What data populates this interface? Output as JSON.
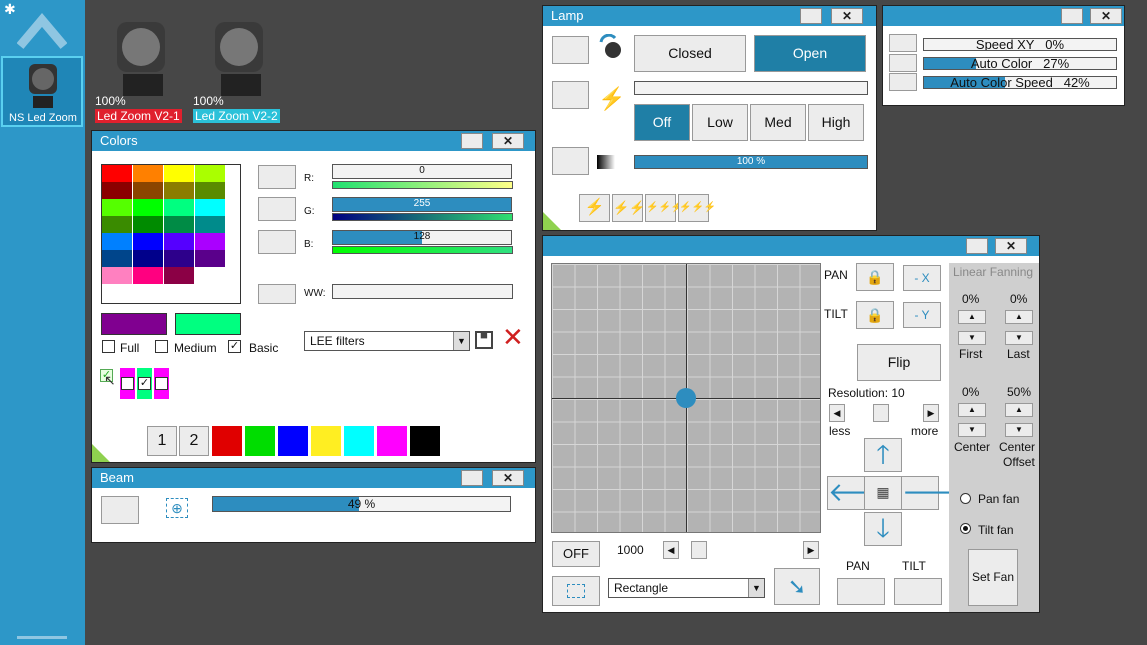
{
  "sidebar": {
    "fixture_label": "NS Led Zoom"
  },
  "fixtures": [
    {
      "percent": "100%",
      "name": "Led Zoom V2-1",
      "color": "#e0202d"
    },
    {
      "percent": "100%",
      "name": "Led Zoom V2-2",
      "color": "#2bc1d9"
    }
  ],
  "colors_panel": {
    "title": "Colors",
    "palette": [
      [
        "#ff0000",
        "#ff8000",
        "#ffff00",
        "#aaff00"
      ],
      [
        "#8b0000",
        "#8b4500",
        "#8b7d00",
        "#5a8b00"
      ],
      [
        "#55ff00",
        "#00ff00",
        "#00ff80",
        "#00ffff"
      ],
      [
        "#3a8b00",
        "#008b00",
        "#008b45",
        "#008b8b"
      ],
      [
        "#0080ff",
        "#0000ff",
        "#5500ff",
        "#aa00ff"
      ],
      [
        "#00458b",
        "#00008b",
        "#2d008b",
        "#5a008b"
      ],
      [
        "#ff80c0",
        "#ff0080",
        "#8b0045",
        "#ffffff"
      ]
    ],
    "r_label": "R:",
    "r_value": "0",
    "r_fraction": 0,
    "g_label": "G:",
    "g_value": "255",
    "g_fraction": 1,
    "b_label": "B:",
    "b_value": "128",
    "b_fraction": 0.5,
    "ww_label": "WW:",
    "preview_a": "#800090",
    "preview_b": "#00ff80",
    "opt_full": "Full",
    "opt_medium": "Medium",
    "opt_basic": "Basic",
    "filter_select": "LEE filters",
    "page_1": "1",
    "page_2": "2",
    "quick_colors": [
      "#e00000",
      "#00dd00",
      "#0000ff",
      "#ffee22",
      "#00ffff",
      "#ff00ff",
      "#000000"
    ],
    "mini_swatch_colors": [
      "#ff00ff",
      "#00ff80",
      "#ff00ff"
    ]
  },
  "beam_panel": {
    "title": "Beam",
    "value_text": "49 %",
    "value_fraction": 0.49
  },
  "lamp_panel": {
    "title": "Lamp",
    "closed": "Closed",
    "open": "Open",
    "off": "Off",
    "low": "Low",
    "med": "Med",
    "high": "High",
    "dimmer_text": "100 %",
    "dimmer_fraction": 1
  },
  "auto_panel": {
    "rows": [
      {
        "label": "Speed XY",
        "value": "0%",
        "fraction": 0
      },
      {
        "label": "Auto Color",
        "value": "27%",
        "fraction": 0.27
      },
      {
        "label": "Auto Color Speed",
        "value": "42%",
        "fraction": 0.42
      }
    ]
  },
  "position_panel": {
    "pan": "PAN",
    "tilt": "TILT",
    "minus_x": "- X",
    "minus_y": "- Y",
    "flip": "Flip",
    "resolution": "Resolution: 10",
    "less": "less",
    "more": "more",
    "pan_bottom": "PAN",
    "tilt_bottom": "TILT",
    "off": "OFF",
    "speed": "1000",
    "shape_select": "Rectangle",
    "linear_fanning": "Linear Fanning",
    "first_pct": "0%",
    "last_pct": "0%",
    "first": "First",
    "last": "Last",
    "center_pct": "0%",
    "offset_pct": "50%",
    "center": "Center",
    "center_offset_1": "Center",
    "center_offset_2": "Offset",
    "pan_fan": "Pan fan",
    "tilt_fan": "Tilt fan",
    "set_fan": "Set Fan"
  }
}
